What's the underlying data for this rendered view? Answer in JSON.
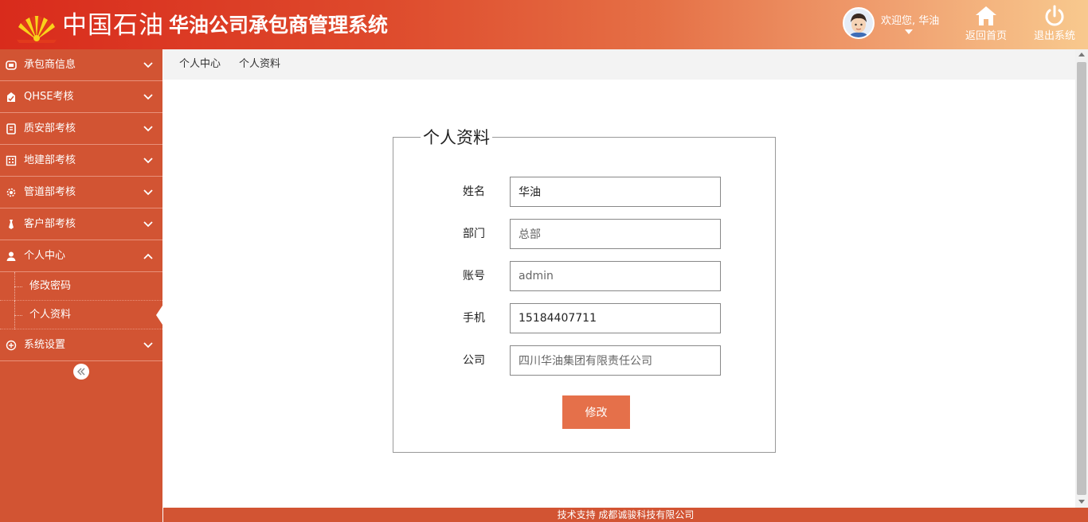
{
  "colors": {
    "brand_red": "#d92b1c",
    "sidebar_bg": "#d25433",
    "button_accent": "#e5704a"
  },
  "header": {
    "company_name": "中国石油",
    "system_title": "华油公司承包商管理系统",
    "welcome_text": "欢迎您, 华油",
    "home_label": "返回首页",
    "logout_label": "退出系统"
  },
  "sidebar": {
    "items": [
      {
        "label": "承包商信息",
        "icon": "id-card-icon"
      },
      {
        "label": "QHSE考核",
        "icon": "document-check-icon"
      },
      {
        "label": "质安部考核",
        "icon": "book-icon"
      },
      {
        "label": "地建部考核",
        "icon": "building-icon"
      },
      {
        "label": "管道部考核",
        "icon": "gear-icon"
      },
      {
        "label": "客户部考核",
        "icon": "tie-icon"
      },
      {
        "label": "个人中心",
        "icon": "user-icon",
        "expanded": true,
        "children": [
          {
            "label": "修改密码"
          },
          {
            "label": "个人资料",
            "active": true
          }
        ]
      },
      {
        "label": "系统设置",
        "icon": "plus-circle-icon"
      }
    ]
  },
  "breadcrumb": {
    "level1": "个人中心",
    "level2": "个人资料"
  },
  "form": {
    "legend": "个人资料",
    "fields": [
      {
        "label": "姓名",
        "value": "华油"
      },
      {
        "label": "部门",
        "value": "总部"
      },
      {
        "label": "账号",
        "value": "admin"
      },
      {
        "label": "手机",
        "value": "15184407711"
      },
      {
        "label": "公司",
        "value": "四川华油集团有限责任公司"
      }
    ],
    "submit_label": "修改"
  },
  "footer": {
    "text": "技术支持 成都诚骏科技有限公司"
  }
}
